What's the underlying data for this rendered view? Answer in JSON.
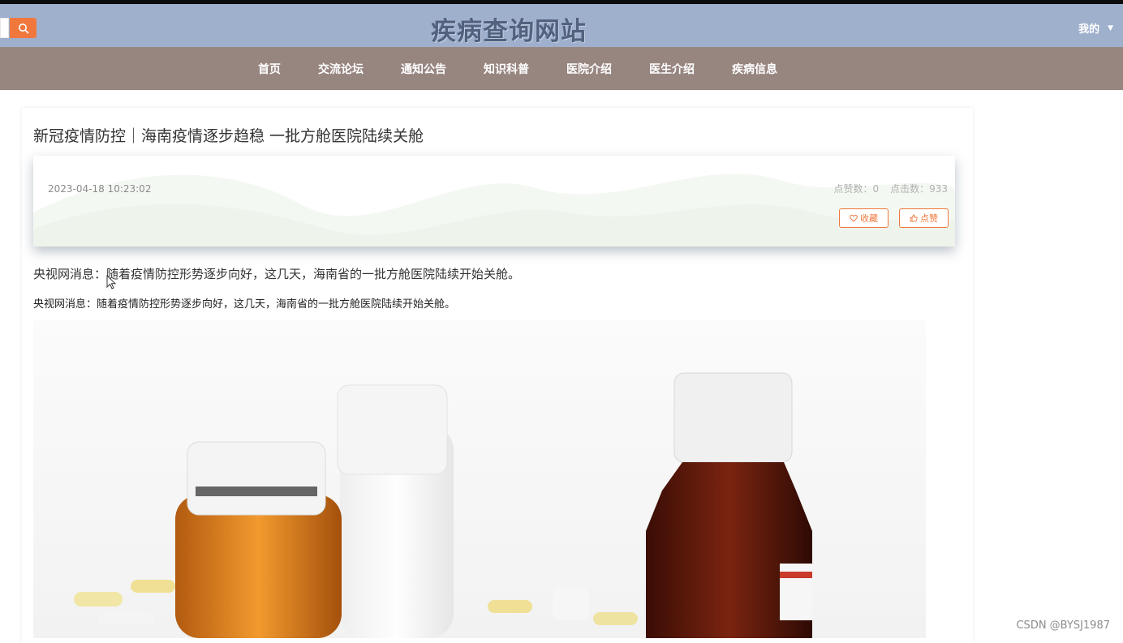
{
  "header": {
    "site_title": "疾病查询网站",
    "mine_label": "我的",
    "search_icon": "search-icon",
    "caret_icon": "caret-down-icon"
  },
  "nav": {
    "items": [
      "首页",
      "交流论坛",
      "通知公告",
      "知识科普",
      "医院介绍",
      "医生介绍",
      "疾病信息"
    ]
  },
  "article": {
    "title": "新冠疫情防控｜海南疫情逐步趋稳 一批方舱医院陆续关舱",
    "date": "2023-04-18 10:23:02",
    "like_count_label": "点赞数：0",
    "click_count_label": "点击数：933",
    "collect_label": "收藏",
    "like_label": "点赞",
    "summary": "央视网消息：随着疫情防控形势逐步向好，这几天，海南省的一批方舱医院陆续开始关舱。",
    "content": "央视网消息：随着疫情防控形势逐步向好，这几天，海南省的一批方舱医院陆续开始关舱。"
  },
  "watermark": "CSDN @BYSJ1987",
  "colors": {
    "header_bg": "#9fb0cd",
    "nav_bg": "#978580",
    "accent": "#f0783d"
  }
}
